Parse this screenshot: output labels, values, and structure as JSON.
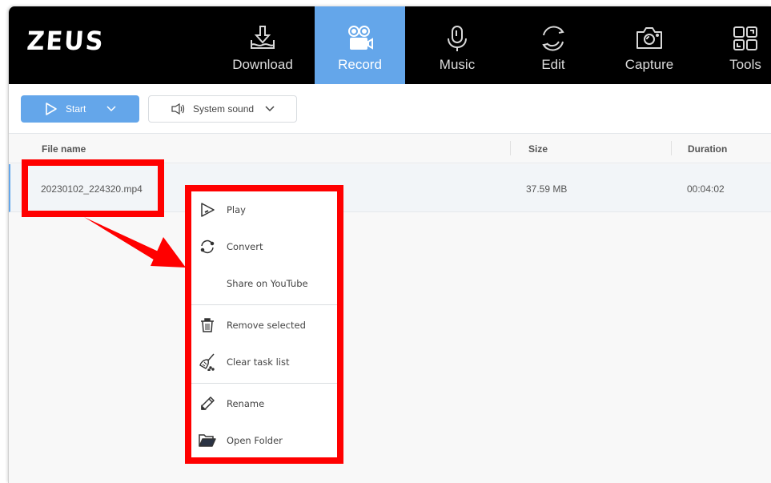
{
  "app": {
    "logo": "ZEUS"
  },
  "nav": {
    "items": [
      {
        "label": "Download",
        "icon": "download-icon"
      },
      {
        "label": "Record",
        "icon": "video-camera-icon",
        "active": true
      },
      {
        "label": "Music",
        "icon": "microphone-icon"
      },
      {
        "label": "Edit",
        "icon": "refresh-icon"
      },
      {
        "label": "Capture",
        "icon": "camera-icon"
      },
      {
        "label": "Tools",
        "icon": "grid-icon"
      }
    ]
  },
  "toolbar": {
    "start_label": "Start",
    "sound_label": "System sound"
  },
  "table": {
    "headers": [
      "File name",
      "Size",
      "Duration"
    ],
    "rows": [
      {
        "file_name": "20230102_224320.mp4",
        "size": "37.59 MB",
        "duration": "00:04:02"
      }
    ]
  },
  "context_menu": {
    "items": [
      {
        "label": "Play",
        "icon": "play-icon"
      },
      {
        "label": "Convert",
        "icon": "convert-icon"
      },
      {
        "label": "Share on YouTube",
        "icon": ""
      },
      {
        "label": "Remove selected",
        "icon": "trash-icon"
      },
      {
        "label": "Clear task list",
        "icon": "broom-icon"
      },
      {
        "label": "Rename",
        "icon": "pencil-icon"
      },
      {
        "label": "Open Folder",
        "icon": "folder-icon"
      }
    ]
  },
  "colors": {
    "accent": "#64a6ea",
    "annotation": "#ff0000",
    "topbar": "#000000"
  }
}
